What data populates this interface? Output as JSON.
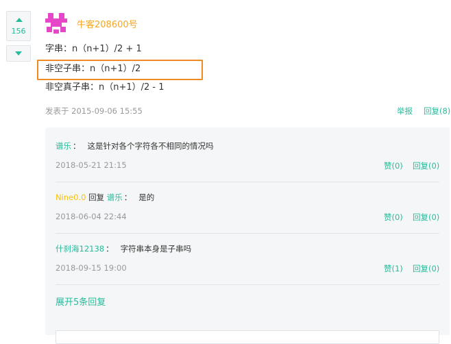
{
  "vote": {
    "count": "156"
  },
  "author": {
    "name": "牛客208600号"
  },
  "content": {
    "line1": "字串：n（n+1）/2 + 1",
    "line2": "非空子串：n（n+1）/2",
    "line3": "非空真子串：n（n+1）/2 - 1"
  },
  "meta": {
    "posted": "发表于 2015-09-06 15:55",
    "report": "举报",
    "reply": "回复(8)"
  },
  "replies": [
    {
      "user": "谱乐",
      "text": "这是针对各个字符各不相同的情况吗",
      "date": "2018-05-21 21:15",
      "like": "赞(0)",
      "reply": "回复(0)"
    },
    {
      "user": "Nine0.0",
      "reply_word": "回复",
      "target": "谱乐",
      "text": "是的",
      "date": "2018-06-04 22:44",
      "like": "赞(0)",
      "reply": "回复(0)"
    },
    {
      "user": "什刹海12138",
      "text": "字符串本身是子串吗",
      "date": "2018-09-15 19:00",
      "like": "赞(1)",
      "reply": "回复(0)"
    }
  ],
  "expand": "展开5条回复",
  "colors": {
    "accent": "#25bb9b",
    "author": "#f5a623",
    "highlight": "#f08a24",
    "panel": "#f4f6f7"
  }
}
